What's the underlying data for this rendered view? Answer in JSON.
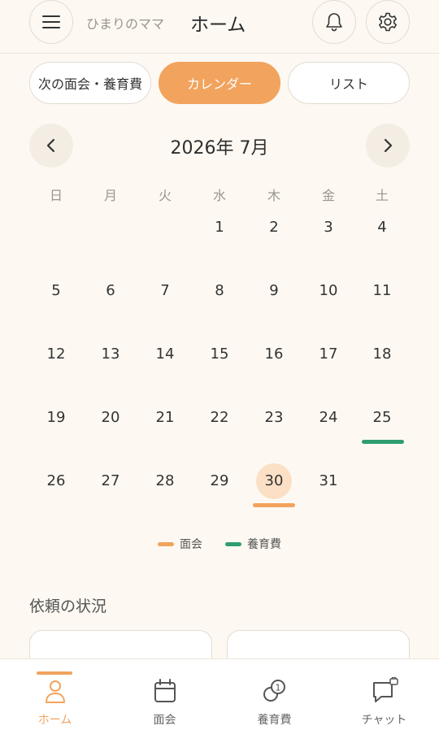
{
  "header": {
    "user_name": "ひまりのママ",
    "title": "ホーム",
    "menu_icon": "hamburger-menu-icon",
    "bell_icon": "bell-icon",
    "gear_icon": "gear-icon"
  },
  "tabs": [
    {
      "label": "次の面会・養育費",
      "active": false
    },
    {
      "label": "カレンダー",
      "active": true
    },
    {
      "label": "リスト",
      "active": false
    }
  ],
  "calendar": {
    "month_label": "2026年 7月",
    "weekdays": [
      "日",
      "月",
      "火",
      "水",
      "木",
      "金",
      "土"
    ],
    "days": [
      "1",
      "2",
      "3",
      "4",
      "5",
      "6",
      "7",
      "8",
      "9",
      "10",
      "11",
      "12",
      "13",
      "14",
      "15",
      "16",
      "17",
      "18",
      "19",
      "20",
      "21",
      "22",
      "23",
      "24",
      "25",
      "26",
      "27",
      "28",
      "29",
      "30",
      "31"
    ],
    "first_weekday_index": 3,
    "today": "30",
    "visit_days": [
      "30"
    ],
    "support_days": [
      "25"
    ]
  },
  "legend": {
    "visit": "面会",
    "support": "養育費"
  },
  "colors": {
    "accent": "#F2A35E",
    "support": "#2E9E6E",
    "background": "#FDF9F2"
  },
  "requests": {
    "title": "依頼の状況"
  },
  "bottom_nav": [
    {
      "label": "ホーム",
      "icon": "person-icon",
      "active": true
    },
    {
      "label": "面会",
      "icon": "calendar-icon",
      "active": false
    },
    {
      "label": "養育費",
      "icon": "coins-icon",
      "active": false
    },
    {
      "label": "チャット",
      "icon": "chat-lock-icon",
      "active": false
    }
  ]
}
